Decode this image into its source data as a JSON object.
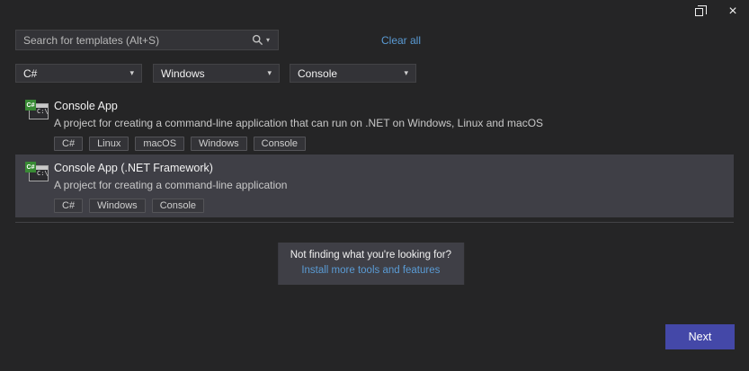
{
  "window": {
    "maximize_label": "maximize",
    "close_label": "close"
  },
  "search": {
    "placeholder": "Search for templates (Alt+S)",
    "clear_all": "Clear all"
  },
  "filters": [
    {
      "label": "C#"
    },
    {
      "label": "Windows"
    },
    {
      "label": "Console"
    }
  ],
  "templates": [
    {
      "title": "Console App",
      "description": "A project for creating a command-line application that can run on .NET on Windows, Linux and macOS",
      "icon_badge": "C#",
      "icon_body": "C:\\",
      "tags": [
        "C#",
        "Linux",
        "macOS",
        "Windows",
        "Console"
      ],
      "selected": false
    },
    {
      "title": "Console App (.NET Framework)",
      "description": "A project for creating a command-line application",
      "icon_badge": "C#",
      "icon_body": "C:\\",
      "tags": [
        "C#",
        "Windows",
        "Console"
      ],
      "selected": true
    }
  ],
  "not_finding": {
    "line1": "Not finding what you're looking for?",
    "link": "Install more tools and features"
  },
  "footer": {
    "next_label": "Next"
  },
  "colors": {
    "background": "#252526",
    "panel": "#333337",
    "selected_row": "#3f3f46",
    "link_blue": "#5a9bd4",
    "next_button": "#4448a8",
    "icon_green": "#388a34"
  }
}
